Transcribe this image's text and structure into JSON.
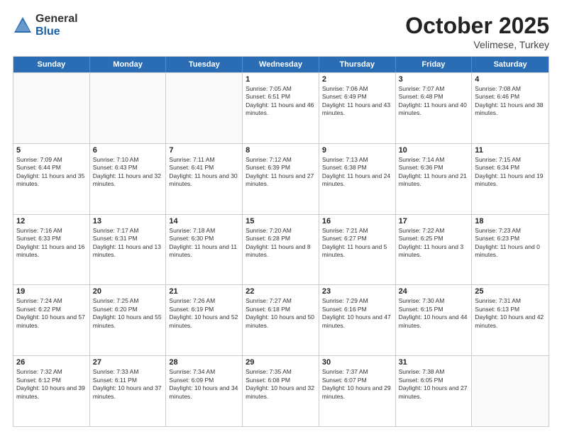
{
  "logo": {
    "general": "General",
    "blue": "Blue"
  },
  "title": "October 2025",
  "location": "Velimese, Turkey",
  "days_of_week": [
    "Sunday",
    "Monday",
    "Tuesday",
    "Wednesday",
    "Thursday",
    "Friday",
    "Saturday"
  ],
  "rows": [
    [
      {
        "day": "",
        "empty": true
      },
      {
        "day": "",
        "empty": true
      },
      {
        "day": "",
        "empty": true
      },
      {
        "day": "1",
        "sunrise": "7:05 AM",
        "sunset": "6:51 PM",
        "daylight": "11 hours and 46 minutes."
      },
      {
        "day": "2",
        "sunrise": "7:06 AM",
        "sunset": "6:49 PM",
        "daylight": "11 hours and 43 minutes."
      },
      {
        "day": "3",
        "sunrise": "7:07 AM",
        "sunset": "6:48 PM",
        "daylight": "11 hours and 40 minutes."
      },
      {
        "day": "4",
        "sunrise": "7:08 AM",
        "sunset": "6:46 PM",
        "daylight": "11 hours and 38 minutes."
      }
    ],
    [
      {
        "day": "5",
        "sunrise": "7:09 AM",
        "sunset": "6:44 PM",
        "daylight": "11 hours and 35 minutes."
      },
      {
        "day": "6",
        "sunrise": "7:10 AM",
        "sunset": "6:43 PM",
        "daylight": "11 hours and 32 minutes."
      },
      {
        "day": "7",
        "sunrise": "7:11 AM",
        "sunset": "6:41 PM",
        "daylight": "11 hours and 30 minutes."
      },
      {
        "day": "8",
        "sunrise": "7:12 AM",
        "sunset": "6:39 PM",
        "daylight": "11 hours and 27 minutes."
      },
      {
        "day": "9",
        "sunrise": "7:13 AM",
        "sunset": "6:38 PM",
        "daylight": "11 hours and 24 minutes."
      },
      {
        "day": "10",
        "sunrise": "7:14 AM",
        "sunset": "6:36 PM",
        "daylight": "11 hours and 21 minutes."
      },
      {
        "day": "11",
        "sunrise": "7:15 AM",
        "sunset": "6:34 PM",
        "daylight": "11 hours and 19 minutes."
      }
    ],
    [
      {
        "day": "12",
        "sunrise": "7:16 AM",
        "sunset": "6:33 PM",
        "daylight": "11 hours and 16 minutes."
      },
      {
        "day": "13",
        "sunrise": "7:17 AM",
        "sunset": "6:31 PM",
        "daylight": "11 hours and 13 minutes."
      },
      {
        "day": "14",
        "sunrise": "7:18 AM",
        "sunset": "6:30 PM",
        "daylight": "11 hours and 11 minutes."
      },
      {
        "day": "15",
        "sunrise": "7:20 AM",
        "sunset": "6:28 PM",
        "daylight": "11 hours and 8 minutes."
      },
      {
        "day": "16",
        "sunrise": "7:21 AM",
        "sunset": "6:27 PM",
        "daylight": "11 hours and 5 minutes."
      },
      {
        "day": "17",
        "sunrise": "7:22 AM",
        "sunset": "6:25 PM",
        "daylight": "11 hours and 3 minutes."
      },
      {
        "day": "18",
        "sunrise": "7:23 AM",
        "sunset": "6:23 PM",
        "daylight": "11 hours and 0 minutes."
      }
    ],
    [
      {
        "day": "19",
        "sunrise": "7:24 AM",
        "sunset": "6:22 PM",
        "daylight": "10 hours and 57 minutes."
      },
      {
        "day": "20",
        "sunrise": "7:25 AM",
        "sunset": "6:20 PM",
        "daylight": "10 hours and 55 minutes."
      },
      {
        "day": "21",
        "sunrise": "7:26 AM",
        "sunset": "6:19 PM",
        "daylight": "10 hours and 52 minutes."
      },
      {
        "day": "22",
        "sunrise": "7:27 AM",
        "sunset": "6:18 PM",
        "daylight": "10 hours and 50 minutes."
      },
      {
        "day": "23",
        "sunrise": "7:29 AM",
        "sunset": "6:16 PM",
        "daylight": "10 hours and 47 minutes."
      },
      {
        "day": "24",
        "sunrise": "7:30 AM",
        "sunset": "6:15 PM",
        "daylight": "10 hours and 44 minutes."
      },
      {
        "day": "25",
        "sunrise": "7:31 AM",
        "sunset": "6:13 PM",
        "daylight": "10 hours and 42 minutes."
      }
    ],
    [
      {
        "day": "26",
        "sunrise": "7:32 AM",
        "sunset": "6:12 PM",
        "daylight": "10 hours and 39 minutes."
      },
      {
        "day": "27",
        "sunrise": "7:33 AM",
        "sunset": "6:11 PM",
        "daylight": "10 hours and 37 minutes."
      },
      {
        "day": "28",
        "sunrise": "7:34 AM",
        "sunset": "6:09 PM",
        "daylight": "10 hours and 34 minutes."
      },
      {
        "day": "29",
        "sunrise": "7:35 AM",
        "sunset": "6:08 PM",
        "daylight": "10 hours and 32 minutes."
      },
      {
        "day": "30",
        "sunrise": "7:37 AM",
        "sunset": "6:07 PM",
        "daylight": "10 hours and 29 minutes."
      },
      {
        "day": "31",
        "sunrise": "7:38 AM",
        "sunset": "6:05 PM",
        "daylight": "10 hours and 27 minutes."
      },
      {
        "day": "",
        "empty": true
      }
    ]
  ]
}
